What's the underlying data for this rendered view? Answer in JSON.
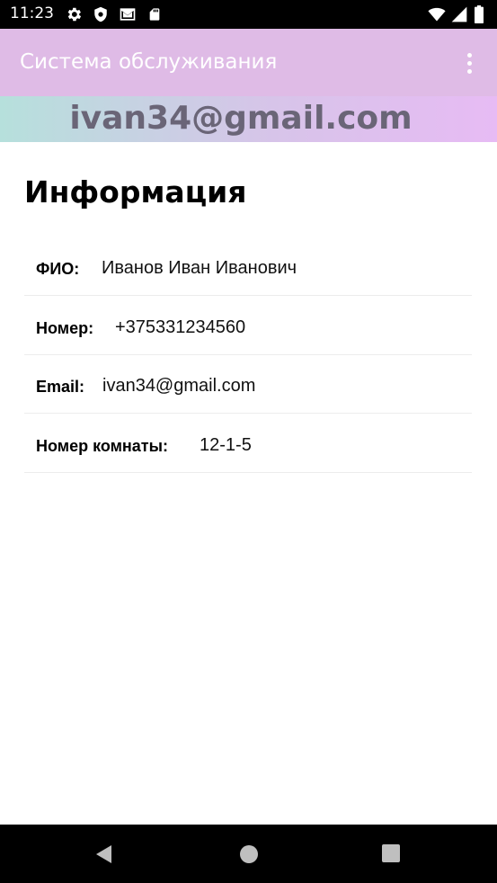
{
  "status_bar": {
    "time": "11:23",
    "icons_left": [
      "gear-icon",
      "shield-icon",
      "gmail-icon",
      "sd-card-icon"
    ],
    "icons_right": [
      "wifi-icon",
      "signal-icon",
      "battery-icon"
    ]
  },
  "app_bar": {
    "title": "Система обслуживания",
    "background": "#dfbbe6",
    "overflow_icon": "more-vert-icon"
  },
  "banner": {
    "email": "ivan34@gmail.com",
    "gradient": [
      "#b6e0dc",
      "#e7bbf4"
    ]
  },
  "page": {
    "title": "Информация",
    "rows": [
      {
        "label": "ФИО:",
        "value": "Иванов Иван Иванович"
      },
      {
        "label": "Номер:",
        "value": "+375331234560"
      },
      {
        "label": "Email:",
        "value": "ivan34@gmail.com"
      },
      {
        "label": "Номер комнаты:",
        "value": "12-1-5"
      }
    ]
  },
  "nav_bar": {
    "icons": [
      "back-icon",
      "home-icon",
      "recents-icon"
    ]
  }
}
